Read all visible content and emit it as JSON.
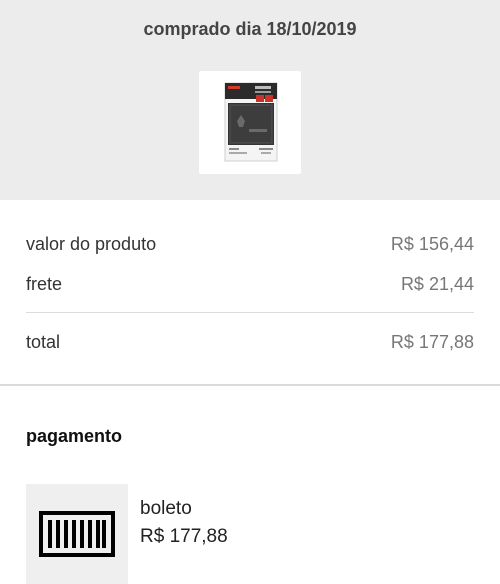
{
  "header": {
    "purchase_date": "comprado dia 18/10/2019",
    "product_image": "ssd-product-thumbnail"
  },
  "costs": {
    "product": {
      "label": "valor do produto",
      "value": "R$ 156,44"
    },
    "shipping": {
      "label": "frete",
      "value": "R$ 21,44"
    },
    "total": {
      "label": "total",
      "value": "R$ 177,88"
    }
  },
  "payment": {
    "title": "pagamento",
    "icon": "barcode-icon",
    "method": "boleto",
    "amount": "R$ 177,88"
  },
  "colors": {
    "header_bg": "#ececec",
    "divider": "#dcdcdc",
    "value_text": "#777777"
  }
}
